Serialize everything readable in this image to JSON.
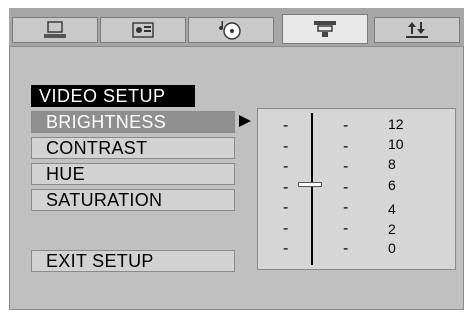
{
  "tabs": [
    {
      "icon": "monitor-icon",
      "active": false
    },
    {
      "icon": "speaker-card-icon",
      "active": false
    },
    {
      "icon": "music-disc-icon",
      "active": false
    },
    {
      "icon": "video-camera-icon",
      "active": true
    },
    {
      "icon": "up-down-arrows-icon",
      "active": false
    }
  ],
  "menu": {
    "title": "VIDEO SETUP",
    "items": [
      {
        "label": "BRIGHTNESS",
        "selected": true
      },
      {
        "label": "CONTRAST",
        "selected": false
      },
      {
        "label": "HUE",
        "selected": false
      },
      {
        "label": "SATURATION",
        "selected": false
      }
    ],
    "exit_label": "EXIT SETUP"
  },
  "slider": {
    "tick_mark": "-",
    "scale": [
      "12",
      "10",
      "8",
      "6",
      "4",
      "2",
      "0"
    ],
    "current_value": 6
  },
  "colors": {
    "selected_bg": "#8f8f8f",
    "title_bg": "#000000",
    "panel_bg": "#c0c0c0"
  }
}
